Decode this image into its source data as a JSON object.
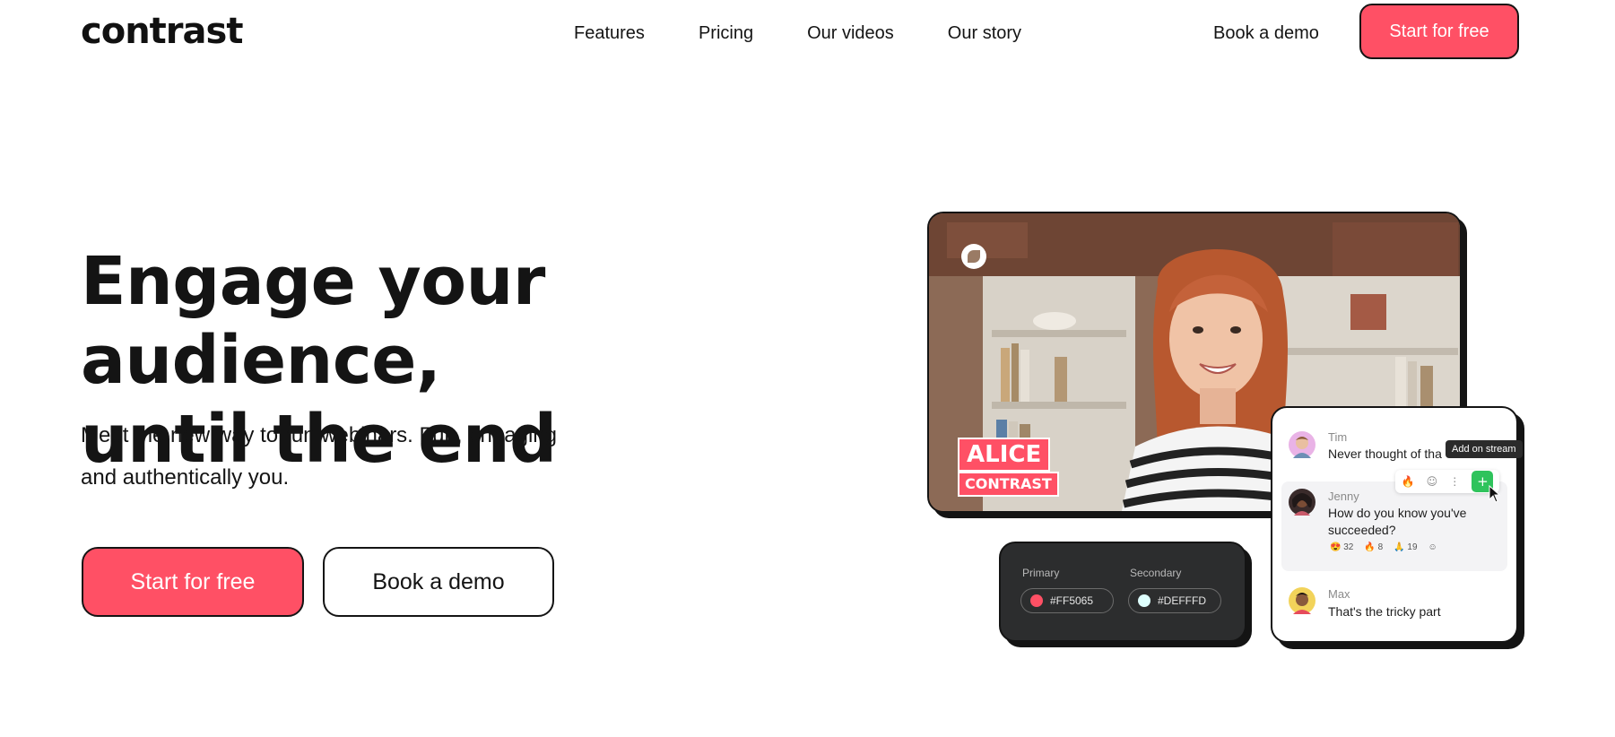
{
  "header": {
    "logo": "contrast",
    "nav": [
      "Features",
      "Pricing",
      "Our videos",
      "Our story"
    ],
    "book_demo": "Book a demo",
    "cta": "Start for free"
  },
  "hero": {
    "title_line1": "Engage your audience,",
    "title_line2": "until the end",
    "subtitle_line1": "Meet the new way to run webinars. Fun, engaging",
    "subtitle_line2": "and authentically you.",
    "primary_button": "Start for free",
    "secondary_button": "Book a demo"
  },
  "video": {
    "name_first": "ALICE",
    "name_last": "CONTRAST"
  },
  "palette": {
    "primary_label": "Primary",
    "primary_value": "#FF5065",
    "secondary_label": "Secondary",
    "secondary_value": "#DEFFFD"
  },
  "chat": {
    "tooltip": "Add on stream",
    "messages": [
      {
        "name": "Tim",
        "text": "Never thought of tha"
      },
      {
        "name": "Jenny",
        "text": "How do you know you've succeeded?"
      },
      {
        "name": "Max",
        "text": "That's the tricky part"
      }
    ],
    "reactions": [
      {
        "icon": "😍",
        "count": "32"
      },
      {
        "icon": "🔥",
        "count": "8"
      },
      {
        "icon": "🙏",
        "count": "19"
      }
    ]
  },
  "colors": {
    "accent": "#FF5065",
    "dark": "#141414",
    "green": "#2fc35c"
  }
}
